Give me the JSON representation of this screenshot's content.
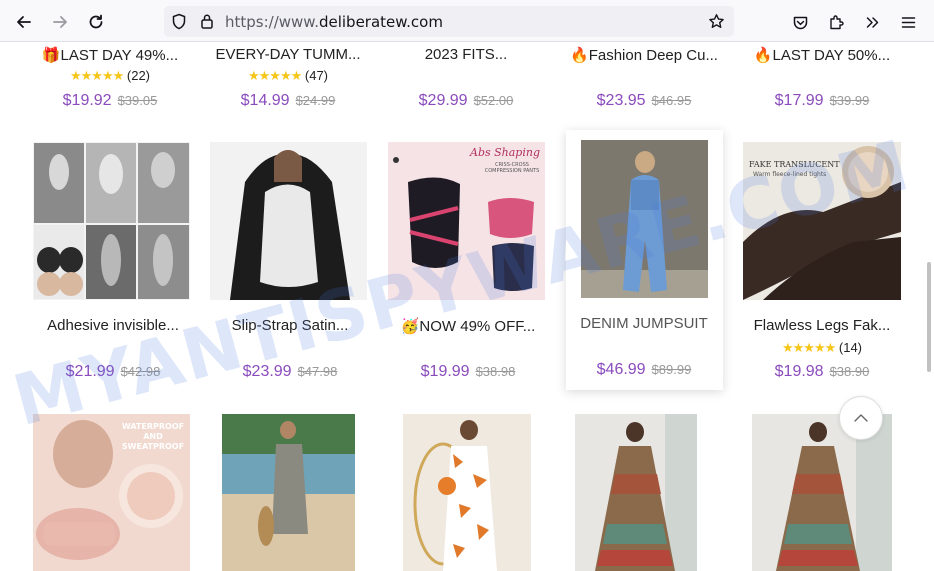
{
  "browser": {
    "url_prefix": "https://www.",
    "url_domain": "deliberatew.com"
  },
  "products_row1": [
    {
      "title": "🎁LAST DAY 49%...",
      "stars": "★★★★★",
      "count": "(22)",
      "price": "$19.92",
      "was": "$39.05"
    },
    {
      "title": "EVERY-DAY TUMM...",
      "stars": "★★★★★",
      "count": "(47)",
      "price": "$14.99",
      "was": "$24.99"
    },
    {
      "title": "2023 FITS...",
      "price": "$29.99",
      "was": "$52.00"
    },
    {
      "title": "🔥Fashion Deep Cu...",
      "price": "$23.95",
      "was": "$46.95"
    },
    {
      "title": "🔥LAST DAY 50%...",
      "price": "$17.99",
      "was": "$39.99"
    }
  ],
  "products_row2": [
    {
      "title": "Adhesive invisible...",
      "price": "$21.99",
      "was": "$42.98"
    },
    {
      "title": "Slip-Strap Satin...",
      "price": "$23.99",
      "was": "$47.98"
    },
    {
      "title": "🥳NOW 49% OFF...",
      "price": "$19.99",
      "was": "$38.98",
      "img_title": "Abs Shaping",
      "img_sub": "CRISS-CROSS COMPRESSION PANTS"
    },
    {
      "title": "DENIM JUMPSUIT",
      "price": "$46.99",
      "was": "$89.99"
    },
    {
      "title": "Flawless Legs Fak...",
      "stars": "★★★★★",
      "count": "(14)",
      "price": "$19.98",
      "was": "$38.90",
      "img_title": "FAKE TRANSLUCENT",
      "img_sub": "Warm fleece-lined tights"
    }
  ],
  "row3_labels": {
    "img1_title": "WATERPROOF AND SWEATPROOF"
  },
  "watermark": "MYANTISPYWARE.COM"
}
